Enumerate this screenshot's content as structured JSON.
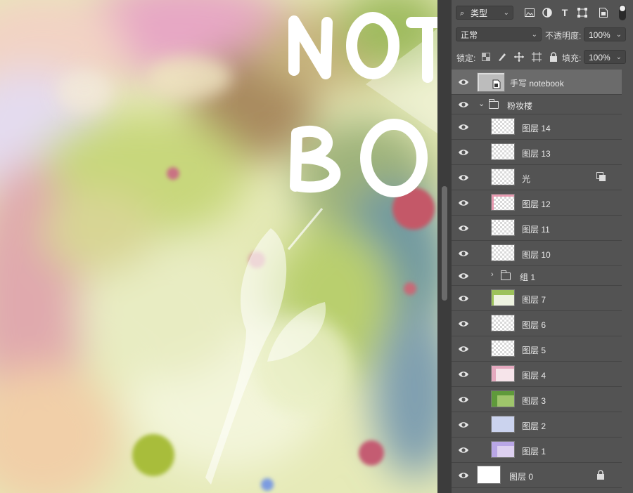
{
  "canvas": {
    "title_letters_line1": "NOT",
    "title_letters_line2": "BO"
  },
  "toolbar": {
    "filter_kind": "类型",
    "blend_mode": "正常",
    "opacity_label": "不透明度:",
    "opacity_value": "100%",
    "lock_label": "锁定:",
    "fill_label": "填充:",
    "fill_value": "100%"
  },
  "layers": [
    {
      "name": "手写 notebook",
      "type": "smart",
      "selected": true,
      "indent": 0
    },
    {
      "name": "粉妆楼",
      "type": "group-open",
      "indent": 0
    },
    {
      "name": "图层 14",
      "type": "layer",
      "indent": 1
    },
    {
      "name": "图层 13",
      "type": "layer",
      "indent": 1
    },
    {
      "name": "光",
      "type": "layer",
      "indent": 1,
      "badge": "clip-icon"
    },
    {
      "name": "图层 12",
      "type": "layer",
      "indent": 1
    },
    {
      "name": "图层 11",
      "type": "layer",
      "indent": 1
    },
    {
      "name": "图层 10",
      "type": "layer",
      "indent": 1
    },
    {
      "name": "组 1",
      "type": "group-closed",
      "indent": 1
    },
    {
      "name": "图层 7",
      "type": "layer",
      "indent": 1
    },
    {
      "name": "图层 6",
      "type": "layer",
      "indent": 1
    },
    {
      "name": "图层 5",
      "type": "layer",
      "indent": 1
    },
    {
      "name": "图层 4",
      "type": "layer",
      "indent": 1
    },
    {
      "name": "图层 3",
      "type": "layer",
      "indent": 1
    },
    {
      "name": "图层 2",
      "type": "layer",
      "indent": 1
    },
    {
      "name": "图层 1",
      "type": "layer",
      "indent": 1
    },
    {
      "name": "图层 0",
      "type": "background",
      "indent": 0,
      "badge": "lock-icon"
    }
  ]
}
